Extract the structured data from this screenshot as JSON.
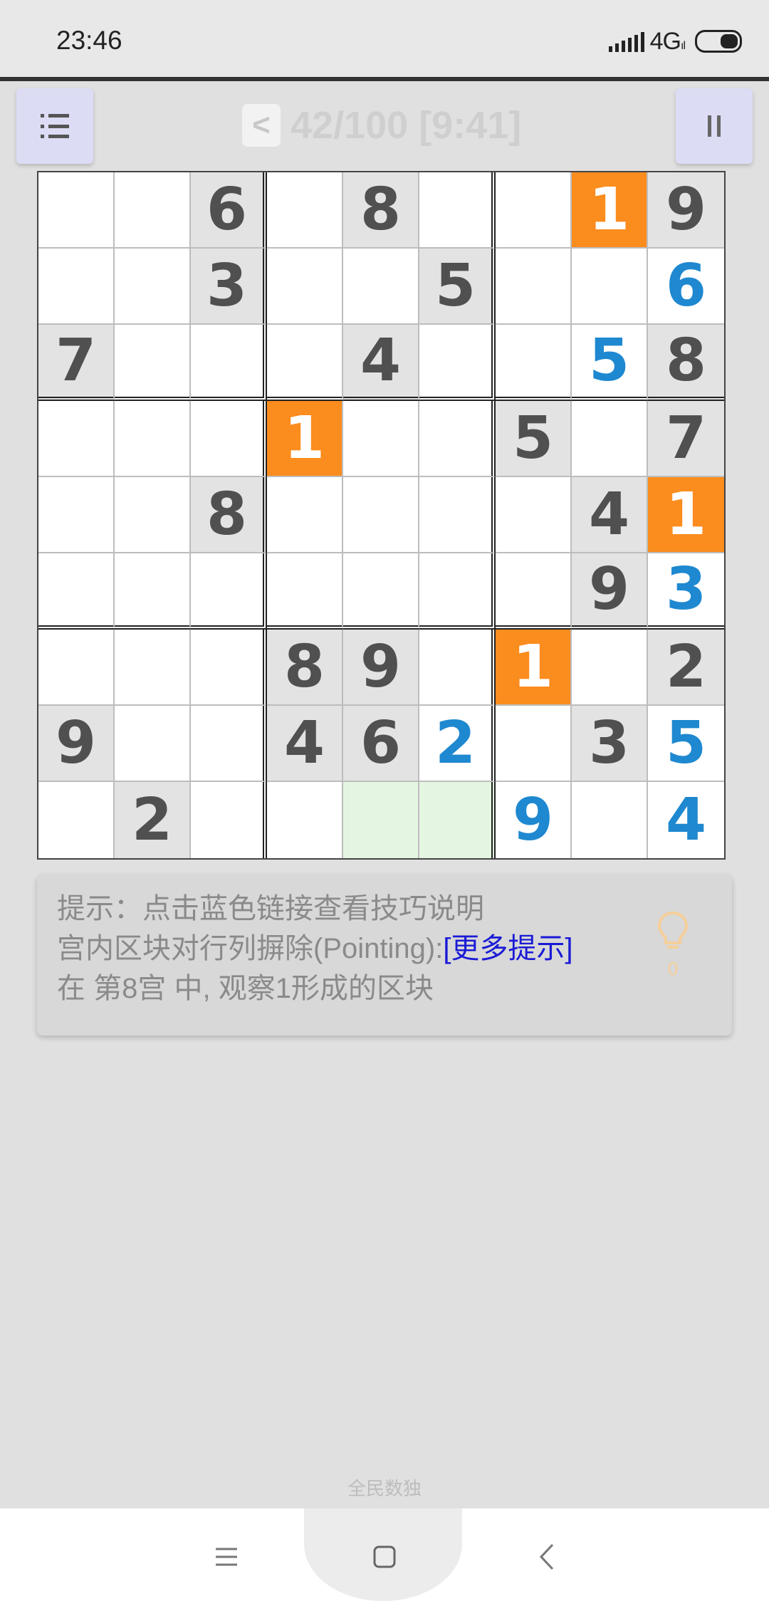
{
  "status_bar": {
    "time": "23:46",
    "network": "4G",
    "network_sub": "ıl"
  },
  "toolbar": {
    "back_label": "<",
    "level_text": "42/100 [9:41]"
  },
  "board": {
    "rows": [
      [
        {
          "v": "",
          "t": "empty"
        },
        {
          "v": "",
          "t": "empty"
        },
        {
          "v": "6",
          "t": "given"
        },
        {
          "v": "",
          "t": "empty"
        },
        {
          "v": "8",
          "t": "given"
        },
        {
          "v": "",
          "t": "empty"
        },
        {
          "v": "",
          "t": "empty"
        },
        {
          "v": "1",
          "t": "hl"
        },
        {
          "v": "9",
          "t": "given"
        }
      ],
      [
        {
          "v": "",
          "t": "empty"
        },
        {
          "v": "",
          "t": "empty"
        },
        {
          "v": "3",
          "t": "given"
        },
        {
          "v": "",
          "t": "empty"
        },
        {
          "v": "",
          "t": "empty"
        },
        {
          "v": "5",
          "t": "given"
        },
        {
          "v": "",
          "t": "empty"
        },
        {
          "v": "",
          "t": "empty"
        },
        {
          "v": "6",
          "t": "user"
        }
      ],
      [
        {
          "v": "7",
          "t": "given"
        },
        {
          "v": "",
          "t": "empty"
        },
        {
          "v": "",
          "t": "empty"
        },
        {
          "v": "",
          "t": "empty"
        },
        {
          "v": "4",
          "t": "given"
        },
        {
          "v": "",
          "t": "empty"
        },
        {
          "v": "",
          "t": "empty"
        },
        {
          "v": "5",
          "t": "user"
        },
        {
          "v": "8",
          "t": "given"
        }
      ],
      [
        {
          "v": "",
          "t": "empty"
        },
        {
          "v": "",
          "t": "empty"
        },
        {
          "v": "",
          "t": "empty"
        },
        {
          "v": "1",
          "t": "hl"
        },
        {
          "v": "",
          "t": "empty"
        },
        {
          "v": "",
          "t": "empty"
        },
        {
          "v": "5",
          "t": "given"
        },
        {
          "v": "",
          "t": "empty"
        },
        {
          "v": "7",
          "t": "given"
        }
      ],
      [
        {
          "v": "",
          "t": "empty"
        },
        {
          "v": "",
          "t": "empty"
        },
        {
          "v": "8",
          "t": "given"
        },
        {
          "v": "",
          "t": "empty"
        },
        {
          "v": "",
          "t": "empty"
        },
        {
          "v": "",
          "t": "empty"
        },
        {
          "v": "",
          "t": "empty"
        },
        {
          "v": "4",
          "t": "given"
        },
        {
          "v": "1",
          "t": "hl"
        }
      ],
      [
        {
          "v": "",
          "t": "empty"
        },
        {
          "v": "",
          "t": "empty"
        },
        {
          "v": "",
          "t": "empty"
        },
        {
          "v": "",
          "t": "empty"
        },
        {
          "v": "",
          "t": "empty"
        },
        {
          "v": "",
          "t": "empty"
        },
        {
          "v": "",
          "t": "empty"
        },
        {
          "v": "9",
          "t": "given"
        },
        {
          "v": "3",
          "t": "user"
        }
      ],
      [
        {
          "v": "",
          "t": "empty"
        },
        {
          "v": "",
          "t": "empty"
        },
        {
          "v": "",
          "t": "empty"
        },
        {
          "v": "8",
          "t": "given"
        },
        {
          "v": "9",
          "t": "given"
        },
        {
          "v": "",
          "t": "empty"
        },
        {
          "v": "1",
          "t": "hl"
        },
        {
          "v": "",
          "t": "empty"
        },
        {
          "v": "2",
          "t": "given"
        }
      ],
      [
        {
          "v": "9",
          "t": "given"
        },
        {
          "v": "",
          "t": "empty"
        },
        {
          "v": "",
          "t": "empty"
        },
        {
          "v": "4",
          "t": "given"
        },
        {
          "v": "6",
          "t": "given"
        },
        {
          "v": "2",
          "t": "user"
        },
        {
          "v": "",
          "t": "empty"
        },
        {
          "v": "3",
          "t": "given"
        },
        {
          "v": "5",
          "t": "user"
        }
      ],
      [
        {
          "v": "",
          "t": "empty"
        },
        {
          "v": "2",
          "t": "given"
        },
        {
          "v": "",
          "t": "empty"
        },
        {
          "v": "",
          "t": "empty"
        },
        {
          "v": "",
          "t": "candidate"
        },
        {
          "v": "",
          "t": "candidate"
        },
        {
          "v": "9",
          "t": "user"
        },
        {
          "v": "",
          "t": "empty"
        },
        {
          "v": "4",
          "t": "user"
        }
      ]
    ]
  },
  "hint": {
    "line1": "提示：点击蓝色链接查看技巧说明",
    "line2_text": "宫内区块对行列摒除(Pointing):",
    "line2_link": "[更多提示]",
    "line3": "在 第8宫 中, 观察1形成的区块",
    "bulb_count": "0"
  },
  "footer": {
    "app_name": "全民数独"
  },
  "colors": {
    "highlight": "#fb8c1e",
    "user_digit": "#1e88d0",
    "given_bg": "#e3e3e3",
    "candidate_bg": "#e4f6e2",
    "link": "#1a1ad6",
    "button_bg": "#dcdcf5"
  },
  "icons": {
    "menu": "menu-list-icon",
    "pause": "pause-icon",
    "bulb": "lightbulb-icon",
    "nav_menu": "hamburger-icon",
    "nav_home": "square-home-icon",
    "nav_back": "chevron-left-icon"
  }
}
